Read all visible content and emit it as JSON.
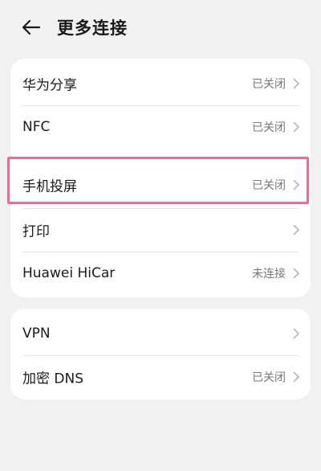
{
  "header": {
    "back_icon": "arrow-left-icon",
    "title": "更多连接"
  },
  "group1": {
    "items": [
      {
        "label": "华为分享",
        "status": "已关闭"
      },
      {
        "label": "NFC",
        "status": "已关闭"
      },
      {
        "label": "手机投屏",
        "status": "已关闭"
      },
      {
        "label": "打印",
        "status": ""
      },
      {
        "label": "Huawei HiCar",
        "status": "未连接"
      }
    ]
  },
  "group2": {
    "items": [
      {
        "label": "VPN",
        "status": ""
      },
      {
        "label": "加密 DNS",
        "status": "已关闭"
      }
    ]
  },
  "colors": {
    "background": "#f1f1f1",
    "card": "#ffffff",
    "highlight": "#ec6c98"
  }
}
